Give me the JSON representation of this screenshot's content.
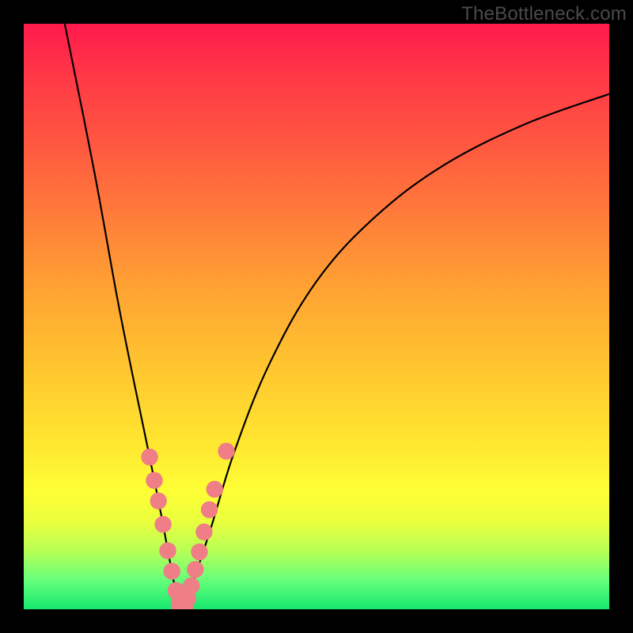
{
  "watermark": "TheBottleneck.com",
  "colors": {
    "frame": "#000000",
    "curve": "#000000",
    "bead": "#ef7e86",
    "gradient_top": "#ff1a4d",
    "gradient_bottom": "#16e86f"
  },
  "chart_data": {
    "type": "line",
    "title": "",
    "xlabel": "",
    "ylabel": "",
    "xlim": [
      0,
      100
    ],
    "ylim": [
      0,
      100
    ],
    "x_min_curve": {
      "x": 27,
      "y": 0
    },
    "series": [
      {
        "name": "left-branch",
        "x": [
          7,
          12,
          16,
          19,
          21.5,
          23.5,
          25,
          26,
          27
        ],
        "y": [
          100,
          75,
          53,
          38,
          26,
          16,
          8,
          3,
          0
        ]
      },
      {
        "name": "right-branch",
        "x": [
          27,
          29,
          32,
          36,
          42,
          50,
          60,
          72,
          86,
          100
        ],
        "y": [
          0,
          5,
          14,
          27,
          42,
          56,
          67,
          76,
          83,
          88
        ]
      }
    ],
    "beads_left": [
      {
        "x": 21.5,
        "y": 26,
        "r": 1.1
      },
      {
        "x": 22.3,
        "y": 22,
        "r": 1.1
      },
      {
        "x": 23.0,
        "y": 18.5,
        "r": 1.1
      },
      {
        "x": 23.8,
        "y": 14.5,
        "r": 1.1
      },
      {
        "x": 24.6,
        "y": 10,
        "r": 1.1
      },
      {
        "x": 25.3,
        "y": 6.5,
        "r": 1.1
      },
      {
        "x": 26.0,
        "y": 3.2,
        "r": 1.1
      },
      {
        "x": 26.6,
        "y": 1.2,
        "r": 1.1
      }
    ],
    "beads_right": [
      {
        "x": 27.5,
        "y": 0.5,
        "r": 1.1
      },
      {
        "x": 28.0,
        "y": 1.8,
        "r": 1.1
      },
      {
        "x": 28.6,
        "y": 4.0,
        "r": 1.1
      },
      {
        "x": 29.3,
        "y": 6.8,
        "r": 1.1
      },
      {
        "x": 30.0,
        "y": 9.8,
        "r": 1.1
      },
      {
        "x": 30.8,
        "y": 13.2,
        "r": 1.1
      },
      {
        "x": 31.7,
        "y": 17.0,
        "r": 1.1
      },
      {
        "x": 32.6,
        "y": 20.5,
        "r": 1.1
      },
      {
        "x": 34.6,
        "y": 27.0,
        "r": 1.1
      }
    ],
    "beads_bottom": [
      {
        "x": 26.7,
        "y": 0.3,
        "r": 1.2
      },
      {
        "x": 27.0,
        "y": 0.1,
        "r": 1.2
      },
      {
        "x": 27.4,
        "y": 0.2,
        "r": 1.2
      }
    ]
  }
}
